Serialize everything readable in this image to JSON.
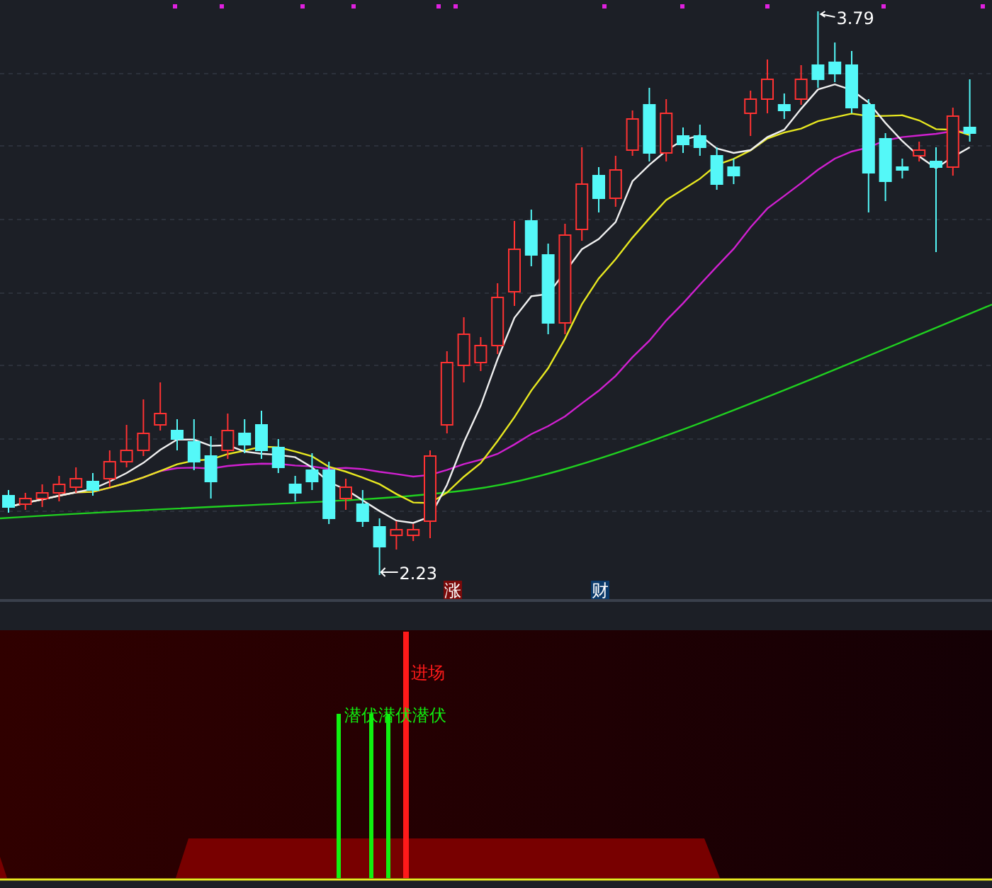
{
  "price_chart": {
    "high_label": "3.79",
    "low_label": "2.23",
    "event_markers": [
      {
        "text": "涨",
        "kind": "limit"
      },
      {
        "text": "财",
        "kind": "finance"
      }
    ]
  },
  "indicator_panel": {
    "signals": [
      {
        "label": "进场",
        "kind": "entry"
      },
      {
        "label": "潜伏",
        "kind": "latent"
      },
      {
        "label": "潜伏",
        "kind": "latent"
      },
      {
        "label": "潜伏",
        "kind": "latent"
      }
    ]
  }
}
